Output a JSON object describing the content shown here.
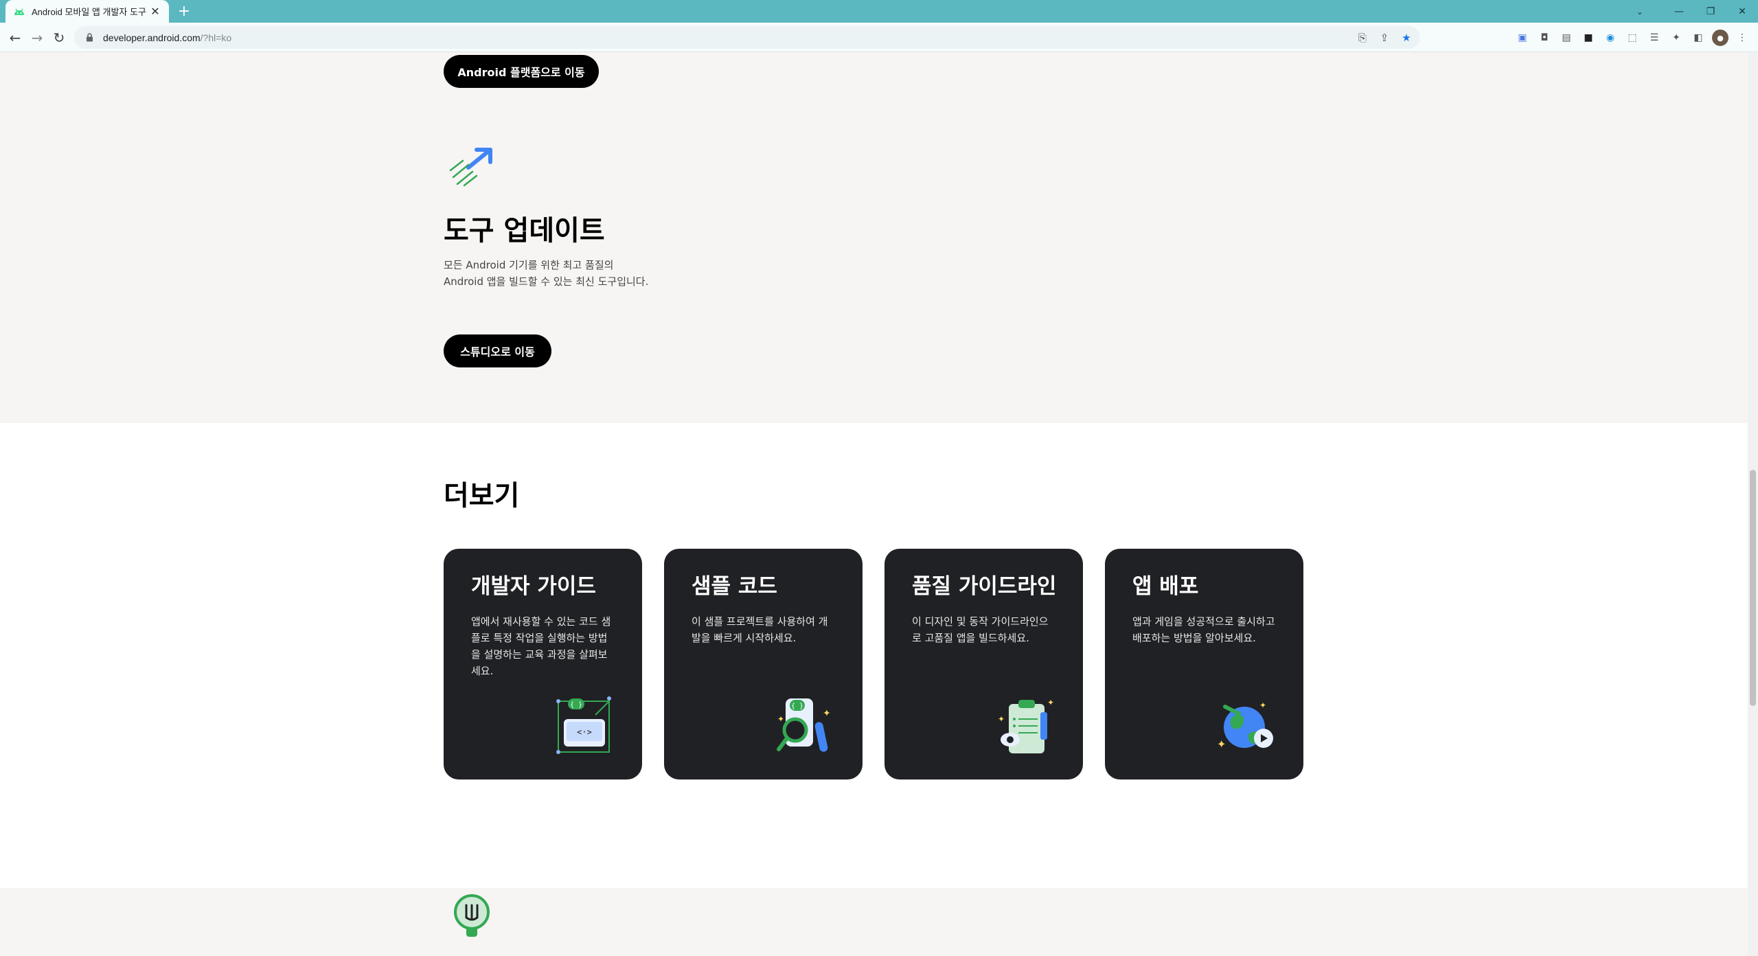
{
  "browser": {
    "tab_title": "Android 모바일 앱 개발자 도구",
    "url_host": "developer.android.com",
    "url_path": "/?hl=ko"
  },
  "section_platform": {
    "button_label": "Android 플랫폼으로 이동"
  },
  "section_tools": {
    "title": "도구 업데이트",
    "description": "모든 Android 기기를 위한 최고 품질의 Android 앱을 빌드할 수 있는 최신 도구입니다.",
    "button_label": "스튜디오로 이동"
  },
  "section_more": {
    "title": "더보기",
    "cards": [
      {
        "title": "개발자 가이드",
        "description": "앱에서 재사용할 수 있는 코드 샘플로 특정 작업을 실행하는 방법을 설명하는 교육 과정을 살펴보세요."
      },
      {
        "title": "샘플 코드",
        "description": "이 샘플 프로젝트를 사용하여 개발을 빠르게 시작하세요."
      },
      {
        "title": "품질 가이드라인",
        "description": "이 디자인 및 동작 가이드라인으로 고품질 앱을 빌드하세요."
      },
      {
        "title": "앱 배포",
        "description": "앱과 게임을 성공적으로 출시하고 배포하는 방법을 알아보세요."
      }
    ]
  },
  "colors": {
    "tabbar": "#5bb8c1",
    "card_bg": "#202124",
    "accent_green": "#34a853",
    "accent_blue": "#4285f4"
  }
}
